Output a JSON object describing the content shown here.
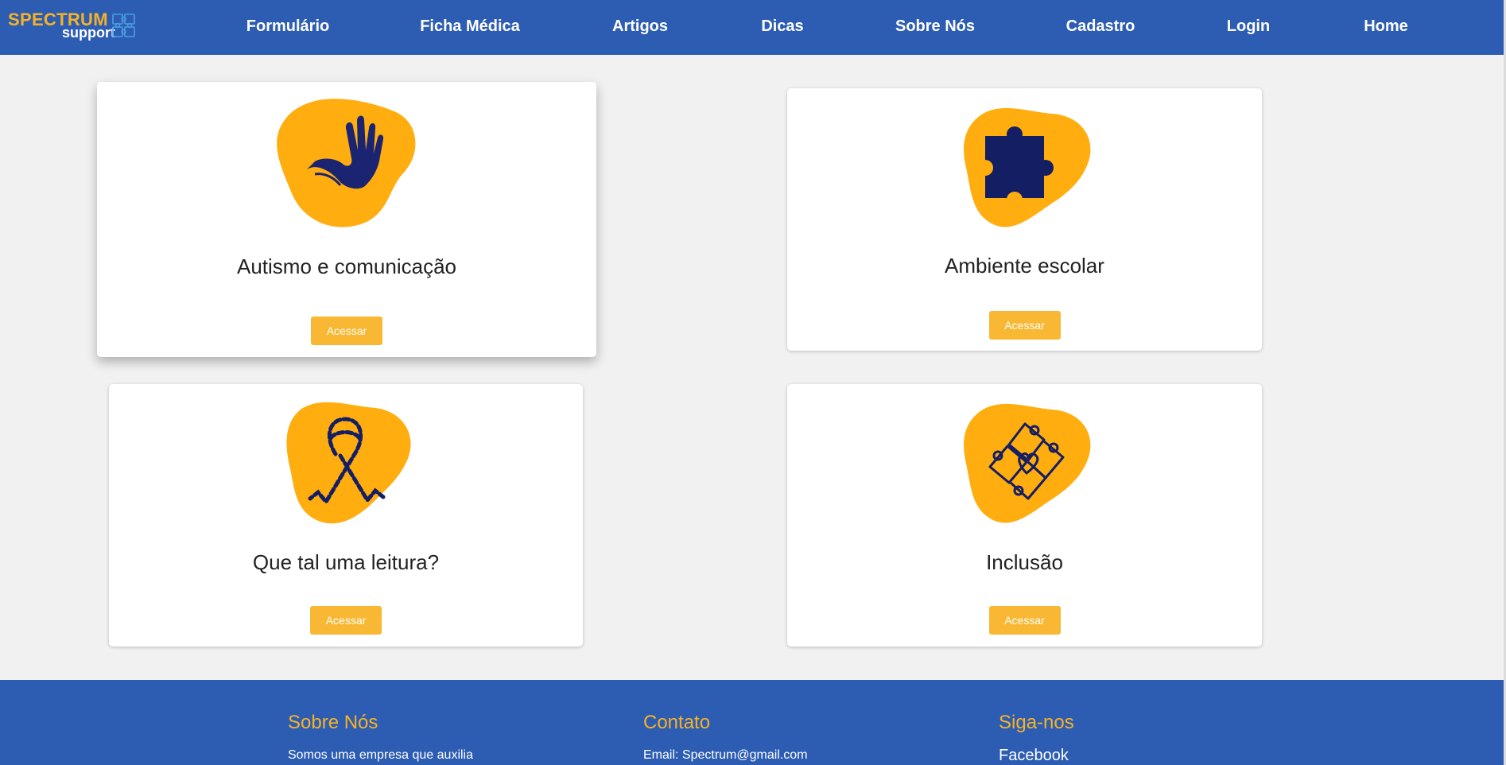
{
  "header": {
    "logo": {
      "word1": "SPECTRUM",
      "word2": "support"
    },
    "nav": [
      {
        "label": "Formulário"
      },
      {
        "label": "Ficha Médica"
      },
      {
        "label": "Artigos"
      },
      {
        "label": "Dicas"
      },
      {
        "label": "Sobre Nós"
      },
      {
        "label": "Cadastro"
      },
      {
        "label": "Login"
      },
      {
        "label": "Home"
      }
    ]
  },
  "cards": [
    {
      "title": "Autismo e comunicação",
      "button": "Acessar",
      "icon": "hand-icon"
    },
    {
      "title": "Ambiente escolar",
      "button": "Acessar",
      "icon": "puzzle-piece-icon"
    },
    {
      "title": "Que tal uma leitura?",
      "button": "Acessar",
      "icon": "ribbon-icon"
    },
    {
      "title": "Inclusão",
      "button": "Acessar",
      "icon": "puzzle-heart-icon"
    }
  ],
  "footer": {
    "about": {
      "heading": "Sobre Nós",
      "text": "Somos uma empresa que auxilia"
    },
    "contact": {
      "heading": "Contato",
      "text": "Email: Spectrum@gmail.com"
    },
    "follow": {
      "heading": "Siga-nos",
      "link": "Facebook"
    }
  },
  "colors": {
    "brand_blue": "#2d5db3",
    "accent_yellow": "#f6b226",
    "blob_orange": "#ffad0f",
    "icon_navy": "#141e63",
    "button_yellow": "#f8b833",
    "background": "#f1f1f1"
  }
}
